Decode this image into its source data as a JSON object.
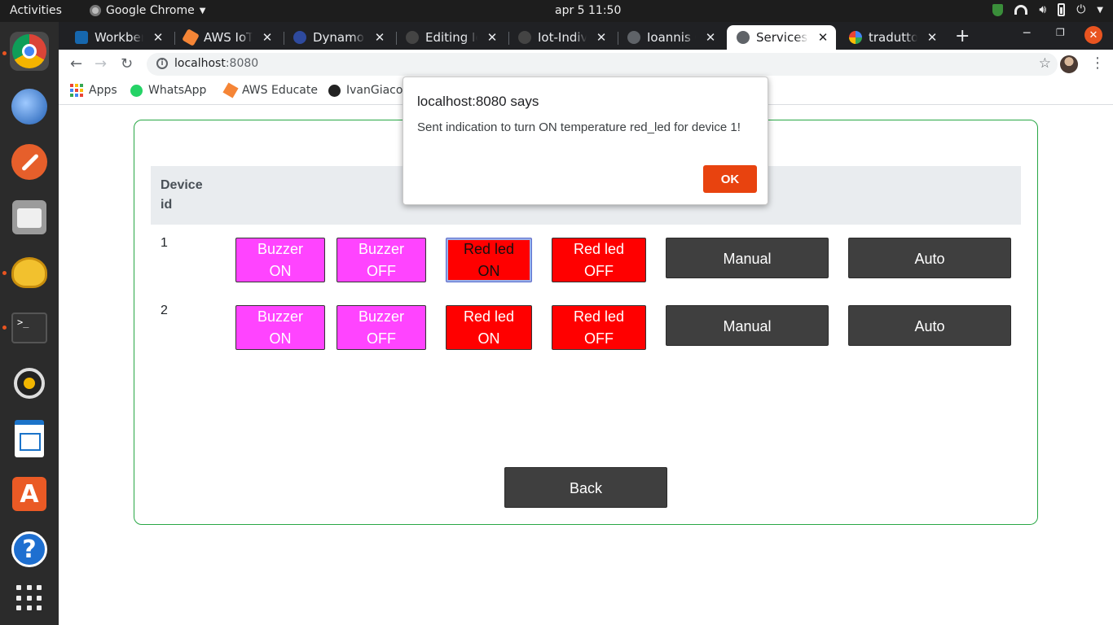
{
  "system": {
    "activities": "Activities",
    "app_menu": "Google Chrome",
    "clock": "apr 5  11:50"
  },
  "dock": {
    "items": [
      "chrome-icon",
      "thunderbird-icon",
      "feather-icon",
      "files-icon",
      "teapot-icon",
      "terminal-icon",
      "speaker-icon",
      "writer-icon",
      "software-store-icon",
      "help-icon",
      "show-apps-icon"
    ]
  },
  "browser": {
    "tabs": [
      {
        "title": "Workbench",
        "favicon_color": "#1667ae"
      },
      {
        "title": "AWS IoT - M",
        "favicon_color": "#f58536"
      },
      {
        "title": "DynamoDB",
        "favicon_color": "#2e4a9e"
      },
      {
        "title": "Editing Iot",
        "favicon_color": "#444444"
      },
      {
        "title": "Iot-Individ",
        "favicon_color": "#444444"
      },
      {
        "title": "Ioannis Ch",
        "favicon_color": "#5f6368"
      },
      {
        "title": "Services av",
        "favicon_color": "#5f6368"
      },
      {
        "title": "traduttore",
        "favicon_color": "#4285f4"
      }
    ],
    "url_host": "localhost",
    "url_port": ":8080",
    "bookmarks": [
      {
        "label": "Apps"
      },
      {
        "label": "WhatsApp"
      },
      {
        "label": "AWS Educate"
      },
      {
        "label": "IvanGiaco"
      }
    ]
  },
  "table": {
    "header_device_id": "Device id",
    "rows": [
      {
        "id": "1",
        "buzzer_on": [
          "Buzzer",
          "ON"
        ],
        "buzzer_off": [
          "Buzzer",
          "OFF"
        ],
        "red_led_on": [
          "Red led",
          "ON"
        ],
        "red_led_off": [
          "Red led",
          "OFF"
        ],
        "manual": "Manual",
        "auto": "Auto"
      },
      {
        "id": "2",
        "buzzer_on": [
          "Buzzer",
          "ON"
        ],
        "buzzer_off": [
          "Buzzer",
          "OFF"
        ],
        "red_led_on": [
          "Red led",
          "ON"
        ],
        "red_led_off": [
          "Red led",
          "OFF"
        ],
        "manual": "Manual",
        "auto": "Auto"
      }
    ]
  },
  "back_label": "Back",
  "alert": {
    "title": "localhost:8080 says",
    "message": "Sent indication to turn ON temperature red_led for device 1!",
    "ok_label": "OK"
  },
  "colors": {
    "buzzer": "#ff44ff",
    "led": "#ff0000",
    "dark_button": "#3f3f3f",
    "card_border": "#28a745",
    "ok_button": "#e8430f"
  }
}
